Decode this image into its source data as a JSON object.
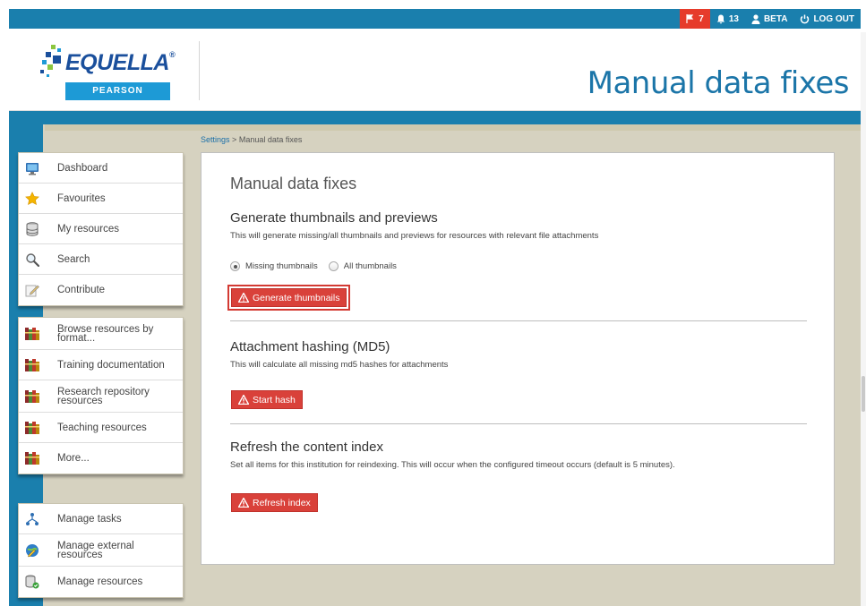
{
  "topbar": {
    "notifications_count": "7",
    "tasks_count": "13",
    "user": "BETA",
    "logout": "LOG OUT"
  },
  "header": {
    "logo_word": "EQUELLA",
    "logo_sub": "PEARSON",
    "page_title": "Manual data fixes"
  },
  "breadcrumb": {
    "parent": "Settings",
    "separator": ">",
    "current": "Manual data fixes"
  },
  "nav_group1": [
    {
      "label": "Dashboard",
      "icon": "dashboard-icon"
    },
    {
      "label": "Favourites",
      "icon": "star-icon"
    },
    {
      "label": "My resources",
      "icon": "database-icon"
    },
    {
      "label": "Search",
      "icon": "magnifier-icon"
    },
    {
      "label": "Contribute",
      "icon": "pencil-icon"
    }
  ],
  "nav_group2": [
    {
      "label": "Browse resources by format...",
      "icon": "books-icon"
    },
    {
      "label": "Training documentation",
      "icon": "books-icon"
    },
    {
      "label": "Research repository resources",
      "icon": "books-icon"
    },
    {
      "label": "Teaching resources",
      "icon": "books-icon"
    },
    {
      "label": "More...",
      "icon": "books-icon"
    }
  ],
  "nav_group3": [
    {
      "label": "Manage tasks",
      "icon": "workflow-icon"
    },
    {
      "label": "Manage external resources",
      "icon": "globe-pencil-icon"
    },
    {
      "label": "Manage resources",
      "icon": "database-check-icon"
    }
  ],
  "main": {
    "heading": "Manual data fixes",
    "thumbnails": {
      "title": "Generate thumbnails and previews",
      "description": "This will generate missing/all thumbnails and previews for resources with relevant file attachments",
      "radio_missing": "Missing thumbnails",
      "radio_all": "All thumbnails",
      "selected": "Missing thumbnails",
      "button": "Generate thumbnails"
    },
    "hashing": {
      "title": "Attachment hashing (MD5)",
      "description": "This will calculate all missing md5 hashes for attachments",
      "button": "Start hash"
    },
    "index": {
      "title": "Refresh the content index",
      "description": "Set all items for this institution for reindexing. This will occur when the configured timeout occurs (default is 5 minutes).",
      "button": "Refresh index"
    }
  },
  "colors": {
    "brand_blue": "#1a7fad",
    "title_blue": "#1b75a8",
    "danger_red": "#d9413a",
    "band_beige": "#d6d2c0"
  }
}
